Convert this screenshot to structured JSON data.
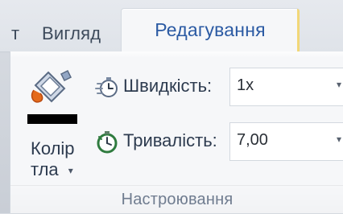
{
  "tabs": {
    "left_cut": "т",
    "view_label": "Вигляд",
    "edit_label": "Редагування"
  },
  "timing": {
    "bg_color_label_1": "Колір",
    "bg_color_label_2": "тла",
    "speed_label": "Швидкість:",
    "speed_value": "1x",
    "duration_label": "Тривалість:",
    "duration_value": "7,00",
    "group_label": "Настроювання"
  },
  "icons": {
    "paint_bucket": "paint-bucket-icon",
    "stopwatch": "stopwatch-icon",
    "timer": "timer-icon",
    "dropdown": "chevron-down-icon"
  },
  "colors": {
    "active_tab_text": "#2b5aa3",
    "accent_tab_edge": "#f2d46a",
    "ribbon_bg": "#f6f7f9",
    "swatch": "#000000"
  }
}
